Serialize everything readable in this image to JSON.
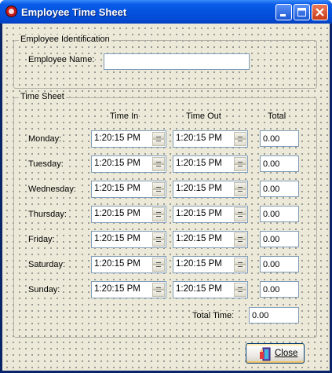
{
  "window": {
    "title": "Employee Time Sheet"
  },
  "identification": {
    "caption": "Employee Identification",
    "name_label": "Employee Name:",
    "name_value": ""
  },
  "timesheet": {
    "caption": "Time Sheet",
    "headers": {
      "time_in": "Time In",
      "time_out": "Time Out",
      "total": "Total"
    },
    "rows": [
      {
        "day": "Monday:",
        "time_in": "1:20:15 PM",
        "time_out": "1:20:15 PM",
        "total": "0.00"
      },
      {
        "day": "Tuesday:",
        "time_in": "1:20:15 PM",
        "time_out": "1:20:15 PM",
        "total": "0.00"
      },
      {
        "day": "Wednesday:",
        "time_in": "1:20:15 PM",
        "time_out": "1:20:15 PM",
        "total": "0.00"
      },
      {
        "day": "Thursday:",
        "time_in": "1:20:15 PM",
        "time_out": "1:20:15 PM",
        "total": "0.00"
      },
      {
        "day": "Friday:",
        "time_in": "1:20:15 PM",
        "time_out": "1:20:15 PM",
        "total": "0.00"
      },
      {
        "day": "Saturday:",
        "time_in": "1:20:15 PM",
        "time_out": "1:20:15 PM",
        "total": "0.00"
      },
      {
        "day": "Sunday:",
        "time_in": "1:20:15 PM",
        "time_out": "1:20:15 PM",
        "total": "0.00"
      }
    ],
    "total_time_label": "Total Time:",
    "total_time_value": "0.00"
  },
  "buttons": {
    "close_label": "Close"
  },
  "icons": {
    "app": "app-icon",
    "minimize": "minimize-icon",
    "maximize": "maximize-icon",
    "close": "close-icon",
    "close_button": "door-exit-icon"
  }
}
